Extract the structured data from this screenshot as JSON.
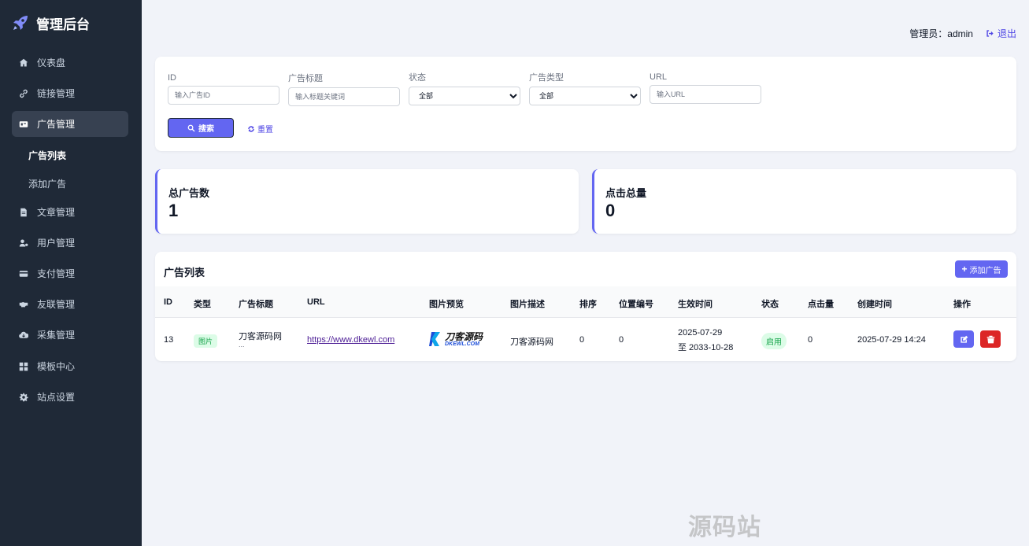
{
  "brand": {
    "title": "管理后台"
  },
  "sidebar": {
    "items": [
      {
        "label": "仪表盘"
      },
      {
        "label": "链接管理"
      },
      {
        "label": "广告管理"
      },
      {
        "label": "文章管理"
      },
      {
        "label": "用户管理"
      },
      {
        "label": "支付管理"
      },
      {
        "label": "友联管理"
      },
      {
        "label": "采集管理"
      },
      {
        "label": "模板中心"
      },
      {
        "label": "站点设置"
      }
    ],
    "sub_items": [
      {
        "label": "广告列表"
      },
      {
        "label": "添加广告"
      }
    ]
  },
  "topbar": {
    "admin_text": "管理员：admin",
    "logout_label": "退出"
  },
  "filters": {
    "id_label": "ID",
    "id_placeholder": "输入广告ID",
    "title_label": "广告标题",
    "title_placeholder": "输入标题关键词",
    "status_label": "状态",
    "status_value": "全部",
    "type_label": "广告类型",
    "type_value": "全部",
    "url_label": "URL",
    "url_placeholder": "输入URL",
    "search_label": "搜索",
    "reset_label": "重置"
  },
  "stats": {
    "total_ads_label": "总广告数",
    "total_ads_value": "1",
    "total_clicks_label": "点击总量",
    "total_clicks_value": "0"
  },
  "table": {
    "title": "广告列表",
    "add_label": "添加广告",
    "headers": [
      "ID",
      "类型",
      "广告标题",
      "URL",
      "图片预览",
      "图片描述",
      "排序",
      "位置编号",
      "生效时间",
      "状态",
      "点击量",
      "创建时间",
      "操作"
    ],
    "rows": [
      {
        "id": "13",
        "type": "图片",
        "title": "刀客源码网",
        "title_more": "...",
        "url": "https://www.dkewl.com",
        "preview_logo": "刀客源码",
        "preview_sub": "DKEWL.COM",
        "desc": "刀客源码网",
        "sort": "0",
        "position": "0",
        "start": "2025-07-29",
        "end": "至 2033-10-28",
        "status": "启用",
        "clicks": "0",
        "created": "2025-07-29 14:24"
      }
    ]
  },
  "watermark": "源码站www.yuanmaz.com",
  "colors": {
    "accent": "#6366f1",
    "sidebar": "#1f2937",
    "danger": "#dc2626",
    "success": "#16a34a"
  }
}
